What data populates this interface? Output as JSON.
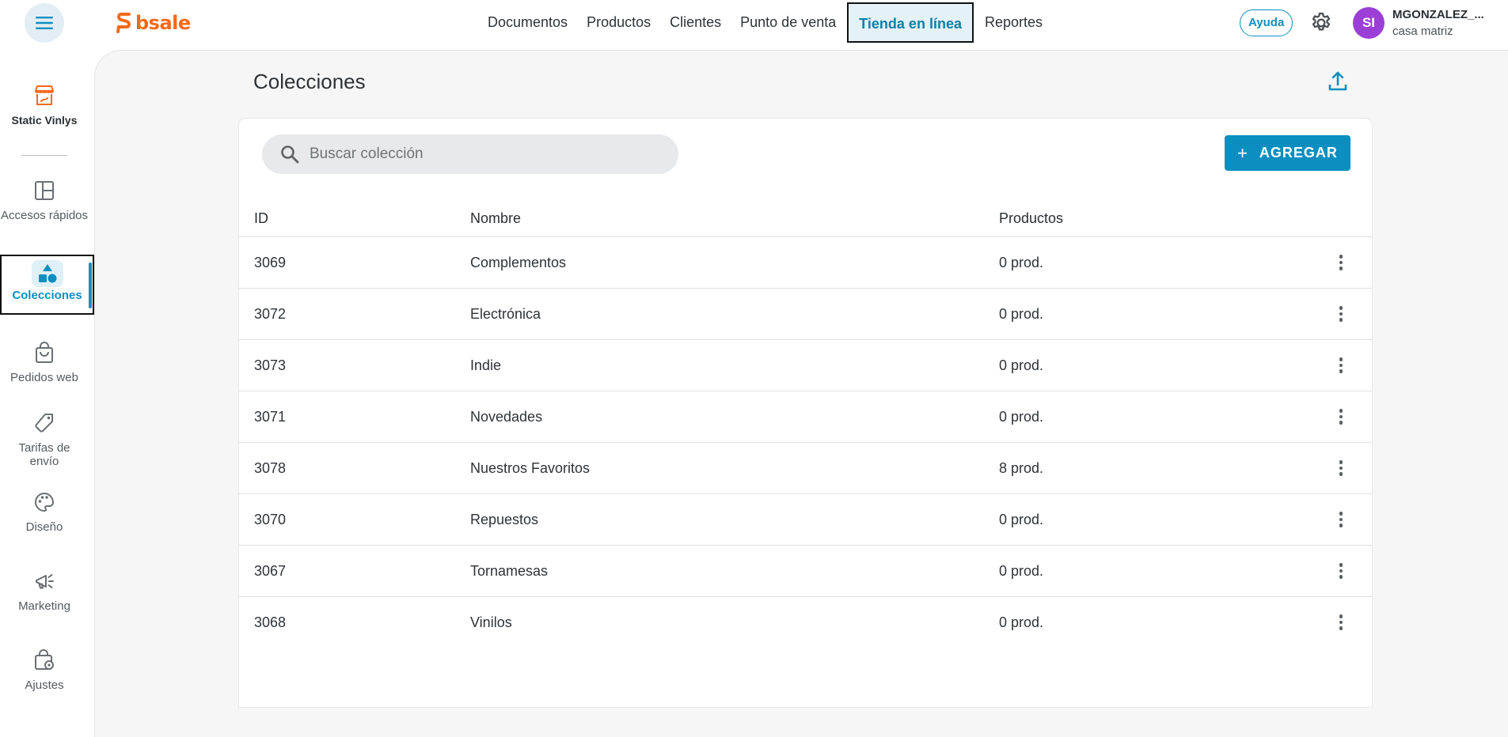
{
  "header": {
    "logo_text": "bsale",
    "nav": [
      {
        "label": "Documentos"
      },
      {
        "label": "Productos"
      },
      {
        "label": "Clientes"
      },
      {
        "label": "Punto de venta"
      },
      {
        "label": "Tienda en línea",
        "active": true
      },
      {
        "label": "Reportes"
      }
    ],
    "help_label": "Ayuda",
    "avatar_initials": "SI",
    "user_name": "MGONZALEZ_...",
    "user_branch": "casa matriz"
  },
  "sidebar": {
    "store_name": "Static Vinlys",
    "items": [
      {
        "label": "Accesos rápidos",
        "icon": "layout-icon"
      },
      {
        "label": "Colecciones",
        "icon": "shapes-icon",
        "active": true
      },
      {
        "label": "Pedidos web",
        "icon": "shopping-bag-icon"
      },
      {
        "label": "Tarifas de envío",
        "icon": "tag-icon"
      },
      {
        "label": "Diseño",
        "icon": "palette-icon"
      },
      {
        "label": "Marketing",
        "icon": "megaphone-icon"
      },
      {
        "label": "Ajustes",
        "icon": "bag-settings-icon"
      }
    ]
  },
  "main": {
    "title": "Colecciones",
    "search_placeholder": "Buscar colección",
    "add_label": "AGREGAR",
    "columns": {
      "id": "ID",
      "name": "Nombre",
      "products": "Productos"
    },
    "rows": [
      {
        "id": "3069",
        "name": "Complementos",
        "products": "0 prod."
      },
      {
        "id": "3072",
        "name": "Electrónica",
        "products": "0 prod."
      },
      {
        "id": "3073",
        "name": "Indie",
        "products": "0 prod."
      },
      {
        "id": "3071",
        "name": "Novedades",
        "products": "0 prod."
      },
      {
        "id": "3078",
        "name": "Nuestros Favoritos",
        "products": "8 prod."
      },
      {
        "id": "3070",
        "name": "Repuestos",
        "products": "0 prod."
      },
      {
        "id": "3067",
        "name": "Tornamesas",
        "products": "0 prod."
      },
      {
        "id": "3068",
        "name": "Vinilos",
        "products": "0 prod."
      }
    ]
  },
  "colors": {
    "accent": "#0c8fc0",
    "brand": "#f26a1b",
    "avatar": "#9b3fd6"
  }
}
